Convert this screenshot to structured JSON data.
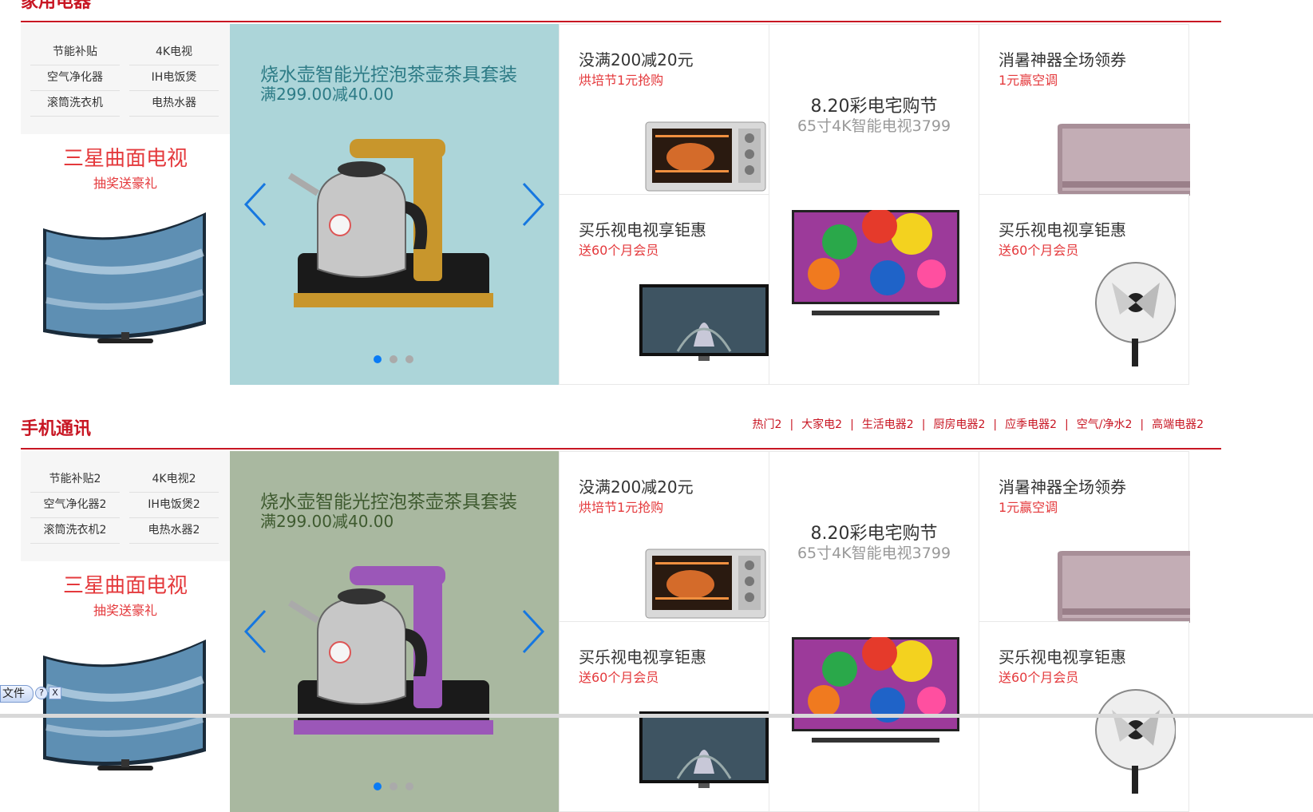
{
  "sections": [
    {
      "title": "家用电器",
      "links": [],
      "categories": [
        "节能补贴",
        "4K电视",
        "空气净化器",
        "IH电饭煲",
        "滚筒洗衣机",
        "电热水器"
      ],
      "promo": {
        "title": "三星曲面电视",
        "subtitle": "抽奖送豪礼"
      },
      "carousel": {
        "title": "烧水壶智能光控泡茶壶茶具套装",
        "subtitle": "满299.00减40.00",
        "bg": "#acd5d9",
        "text_color": "#2d7b86",
        "accent": "#c8962c"
      },
      "cells": {
        "oven": {
          "title": "没满200减20元",
          "subtitle": "烘培节1元抢购"
        },
        "center": {
          "title": "8.20彩电宅购节",
          "subtitle": "65寸4K智能电视3799"
        },
        "aircon": {
          "title": "消暑神器全场领券",
          "subtitle": "1元赢空调"
        },
        "tv": {
          "title": "买乐视电视享钜惠",
          "subtitle": "送60个月会员"
        },
        "fan": {
          "title": "买乐视电视享钜惠",
          "subtitle": "送60个月会员"
        }
      }
    },
    {
      "title": "手机通讯",
      "links": [
        "热门2",
        "大家电2",
        "生活电器2",
        "厨房电器2",
        "应季电器2",
        "空气/净水2",
        "高端电器2"
      ],
      "categories": [
        "节能补贴2",
        "4K电视2",
        "空气净化器2",
        "IH电饭煲2",
        "滚筒洗衣机2",
        "电热水器2"
      ],
      "promo": {
        "title": "三星曲面电视",
        "subtitle": "抽奖送豪礼"
      },
      "carousel": {
        "title": "烧水壶智能光控泡茶壶茶具套装",
        "subtitle": "满299.00减40.00",
        "bg": "#a9b8a0",
        "text_color": "#3e5a2f",
        "accent": "#9b57b8"
      },
      "cells": {
        "oven": {
          "title": "没满200减20元",
          "subtitle": "烘培节1元抢购"
        },
        "center": {
          "title": "8.20彩电宅购节",
          "subtitle": "65寸4K智能电视3799"
        },
        "aircon": {
          "title": "消暑神器全场领券",
          "subtitle": "1元赢空调"
        },
        "tv": {
          "title": "买乐视电视享钜惠",
          "subtitle": "送60个月会员"
        },
        "fan": {
          "title": "买乐视电视享钜惠",
          "subtitle": "送60个月会员"
        }
      }
    }
  ],
  "carousel_dots": {
    "count": 3,
    "active": 1
  },
  "file_widget": {
    "label": "文件",
    "help": "?",
    "close": "X"
  },
  "colors": {
    "brand_red": "#c81623",
    "promo_red": "#e4393c",
    "arrow_blue": "#0a7bf5"
  }
}
